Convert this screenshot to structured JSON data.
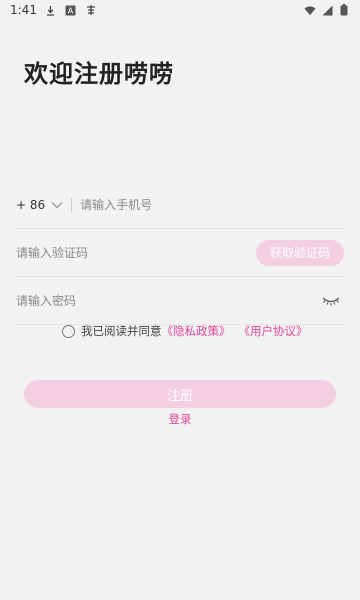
{
  "status_bar": {
    "time": "1:41",
    "icons": [
      "download-icon",
      "a-box-icon",
      "app-icon",
      "wifi-icon",
      "signal-icon",
      "battery-icon"
    ]
  },
  "page": {
    "title": "欢迎注册唠唠"
  },
  "form": {
    "country_code": "+ 86",
    "phone_placeholder": "请输入手机号",
    "code_placeholder": "请输入验证码",
    "get_code_label": "获取验证码",
    "password_placeholder": "请输入密码"
  },
  "agreement": {
    "text": "我已阅读并同意",
    "privacy_link": "《隐私政策》",
    "terms_link": "《用户协议》"
  },
  "actions": {
    "register_label": "注册",
    "login_label": "登录"
  },
  "colors": {
    "accent": "#e0479a",
    "button_bg": "#f3cfe1",
    "background": "#f2f2f2"
  }
}
